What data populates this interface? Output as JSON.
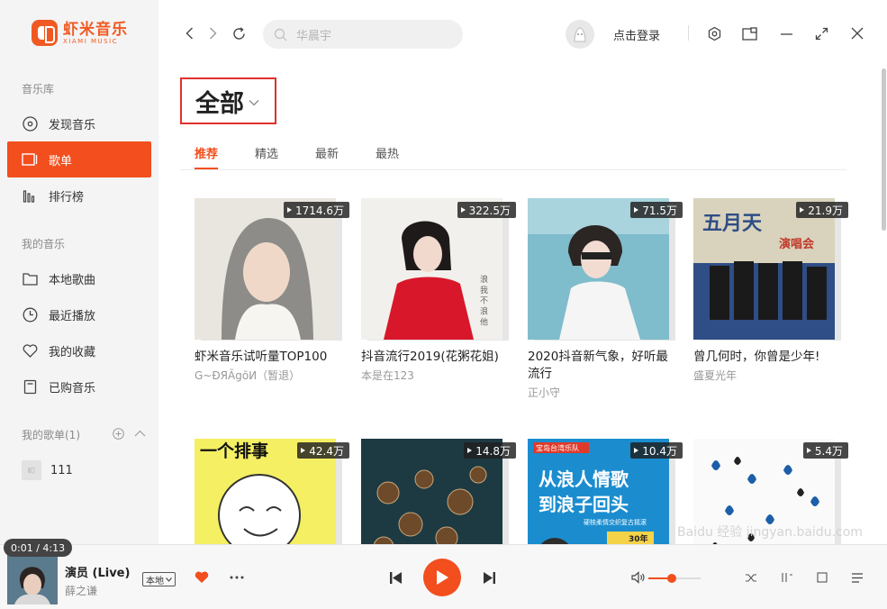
{
  "app": {
    "logo_cn": "虾米音乐",
    "logo_en": "XIAMI MUSIC"
  },
  "sidebar": {
    "library_title": "音乐库",
    "library_items": [
      {
        "label": "发现音乐",
        "icon": "disc-icon"
      },
      {
        "label": "歌单",
        "icon": "playlist-icon",
        "active": true
      },
      {
        "label": "排行榜",
        "icon": "chart-bars-icon"
      }
    ],
    "my_music_title": "我的音乐",
    "my_music_items": [
      {
        "label": "本地歌曲",
        "icon": "folder-icon"
      },
      {
        "label": "最近播放",
        "icon": "clock-icon"
      },
      {
        "label": "我的收藏",
        "icon": "heart-icon"
      },
      {
        "label": "已购音乐",
        "icon": "purchased-icon"
      }
    ],
    "my_playlists_title": "我的歌单(1)",
    "my_playlists": [
      {
        "label": "111"
      }
    ]
  },
  "topbar": {
    "search_placeholder": "华晨宇",
    "login_label": "点击登录"
  },
  "main": {
    "category_title": "全部",
    "tabs": [
      {
        "label": "推荐",
        "active": true
      },
      {
        "label": "精选"
      },
      {
        "label": "最新"
      },
      {
        "label": "最热"
      }
    ],
    "playlists": [
      {
        "title": "虾米音乐试听量TOP100",
        "author": "G~ÐЯÃgõИ（暂退）",
        "plays": "1714.6万",
        "colors": [
          "#8b8b86",
          "#e9e6df"
        ]
      },
      {
        "title": "抖音流行2019(花粥花姐)",
        "author": "本是在123",
        "plays": "322.5万",
        "colors": [
          "#d8172a",
          "#f2f0ec"
        ]
      },
      {
        "title": "2020抖音新气象，好听最流行",
        "author": "正小守",
        "plays": "71.5万",
        "colors": [
          "#6fb3c6",
          "#eaf2f4"
        ]
      },
      {
        "title": "曾几何时，你曾是少年!",
        "author": "盛夏光年",
        "plays": "21.9万",
        "colors": [
          "#2f4d86",
          "#e1dcc8"
        ]
      },
      {
        "title": "",
        "author": "",
        "plays": "42.4万",
        "colors": [
          "#f5ef63",
          "#ffffff"
        ]
      },
      {
        "title": "",
        "author": "",
        "plays": "14.8万",
        "colors": [
          "#1d3a42",
          "#6d4a2a"
        ]
      },
      {
        "title": "",
        "author": "",
        "plays": "10.4万",
        "colors": [
          "#1b8dcf",
          "#f5d348"
        ]
      },
      {
        "title": "",
        "author": "",
        "plays": "5.4万",
        "colors": [
          "#fafafa",
          "#1c5fa8"
        ]
      }
    ],
    "row2_cover_text": {
      "card5": "一个排事",
      "card7_tag": "宝岛台湾乐队",
      "card7_line1": "从浪人情歌",
      "card7_line2": "到浪子回头",
      "card7_small": "硬核柔情交织复古摇滚",
      "card7_years": "30年"
    }
  },
  "player": {
    "time": "0:01 / 4:13",
    "song_title": "演员 (Live)",
    "artist": "薛之谦",
    "local_tag": "本地",
    "volume_level": 0.45,
    "accent": "#f24e1e"
  },
  "watermark": "Baidu 经验  jingyan.baidu.com"
}
